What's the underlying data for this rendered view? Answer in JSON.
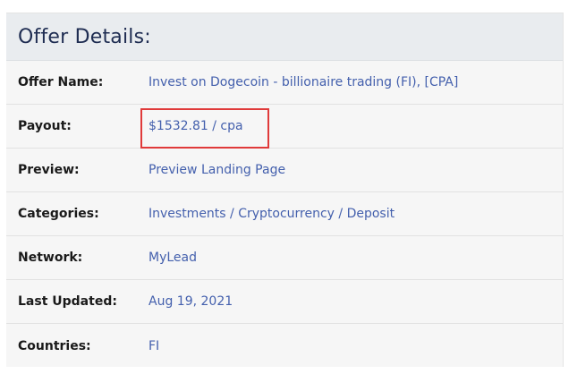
{
  "header": {
    "title": "Offer Details:"
  },
  "rows": [
    {
      "label": "Offer Name:",
      "value": "Invest on Dogecoin - billionaire trading (FI), [CPA]"
    },
    {
      "label": "Payout:",
      "value": "$1532.81 / cpa"
    },
    {
      "label": "Preview:",
      "value": "Preview Landing Page"
    },
    {
      "label": "Categories:",
      "value": "Investments / Cryptocurrency / Deposit"
    },
    {
      "label": "Network:",
      "value": "MyLead"
    },
    {
      "label": "Last Updated:",
      "value": "Aug 19, 2021"
    },
    {
      "label": "Countries:",
      "value": "FI"
    }
  ],
  "colors": {
    "title": "#1f2d52",
    "link": "#4460ad",
    "highlight": "#e03a3a"
  }
}
